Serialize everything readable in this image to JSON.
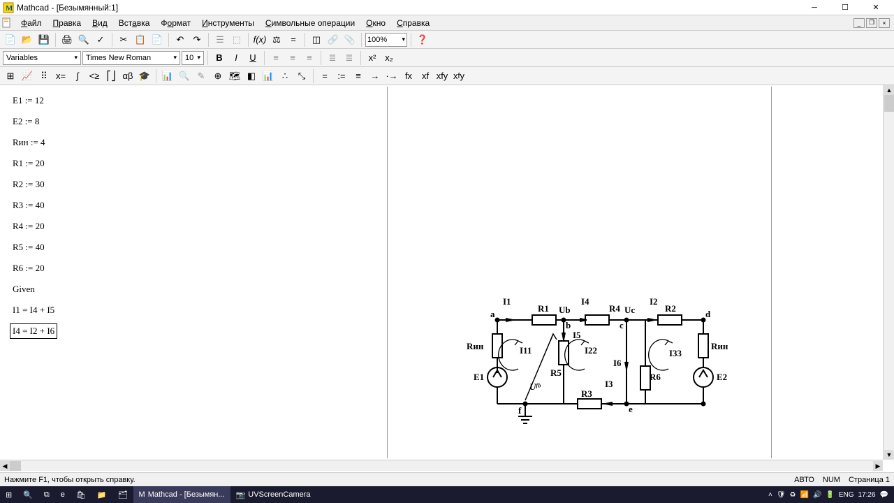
{
  "window": {
    "title": "Mathcad - [Безымянный:1]"
  },
  "menu": {
    "file": "Файл",
    "edit": "Правка",
    "view": "Вид",
    "insert": "Вставка",
    "format": "Формат",
    "tools": "Инструменты",
    "symbolic": "Символьные операции",
    "window": "Окно",
    "help": "Справка"
  },
  "toolbar": {
    "zoom": "100%"
  },
  "format_bar": {
    "style": "Variables",
    "font": "Times New Roman",
    "size": "10"
  },
  "equations": {
    "e1": "E1 := 12",
    "e2": "E2 := 8",
    "rin": "Rин := 4",
    "r1": "R1 := 20",
    "r2": "R2 := 30",
    "r3": "R3 := 40",
    "r4": "R4 := 20",
    "r5": "R5 := 40",
    "r6": "R6 := 20",
    "given": "Given",
    "eq1": "I1 = I4 + I5",
    "eq2": "I4 = I2 + I6"
  },
  "circuit": {
    "labels": {
      "I1": "I1",
      "I2": "I2",
      "I3": "I3",
      "I4": "I4",
      "I5": "I5",
      "I6": "I6",
      "R1": "R1",
      "R2": "R2",
      "R3": "R3",
      "R4": "R4",
      "R5": "R5",
      "R6": "R6",
      "Rin_l": "Rин",
      "Rin_r": "Rин",
      "E1": "E1",
      "E2": "E2",
      "Ub": "Ub",
      "Uc": "Uc",
      "Ufb": "Uᶠᵇ",
      "I11": "I11",
      "I22": "I22",
      "I33": "I33",
      "a": "a",
      "b": "b",
      "c": "c",
      "d": "d",
      "e": "e",
      "f": "f"
    }
  },
  "status": {
    "hint": "Нажмите F1, чтобы открыть справку.",
    "auto": "АВТО",
    "num": "NUM",
    "page": "Страница 1"
  },
  "taskbar": {
    "mathcad": "Mathcad - [Безымян...",
    "uvscreen": "UVScreenCamera",
    "lang": "ENG",
    "time": "17:26"
  }
}
